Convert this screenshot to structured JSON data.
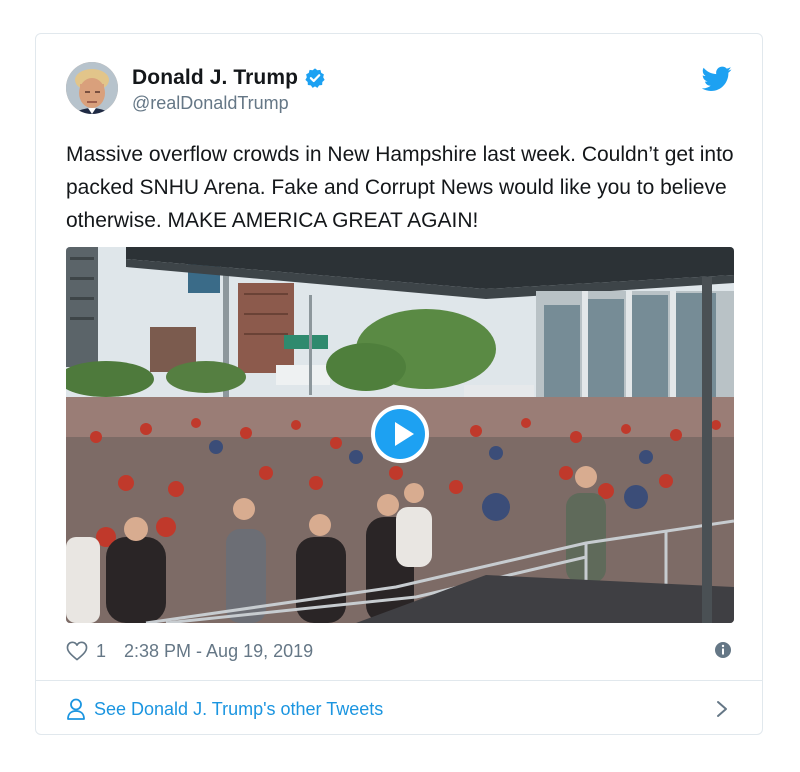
{
  "user": {
    "display_name": "Donald J. Trump",
    "handle": "@realDonaldTrump",
    "verified": true
  },
  "tweet": {
    "text": "Massive overflow crowds in New Hampshire last week. Couldn’t get into packed SNHU Arena. Fake and Corrupt News would like you to believe otherwise. MAKE AMERICA GREAT AGAIN!",
    "media_type": "video",
    "likes": "1",
    "timestamp": "2:38 PM - Aug 19, 2019"
  },
  "footer": {
    "link_label": "See Donald J. Trump's other Tweets"
  },
  "icons": {
    "brand": "twitter-bird-icon",
    "verified": "verified-badge-icon",
    "like": "heart-icon",
    "info": "info-icon",
    "profile": "person-icon",
    "more": "chevron-right-icon",
    "play": "play-icon"
  },
  "colors": {
    "accent": "#1da1f2",
    "link": "#1b95e0",
    "text": "#14171a",
    "secondary": "#657786",
    "border": "#e1e8ed"
  }
}
